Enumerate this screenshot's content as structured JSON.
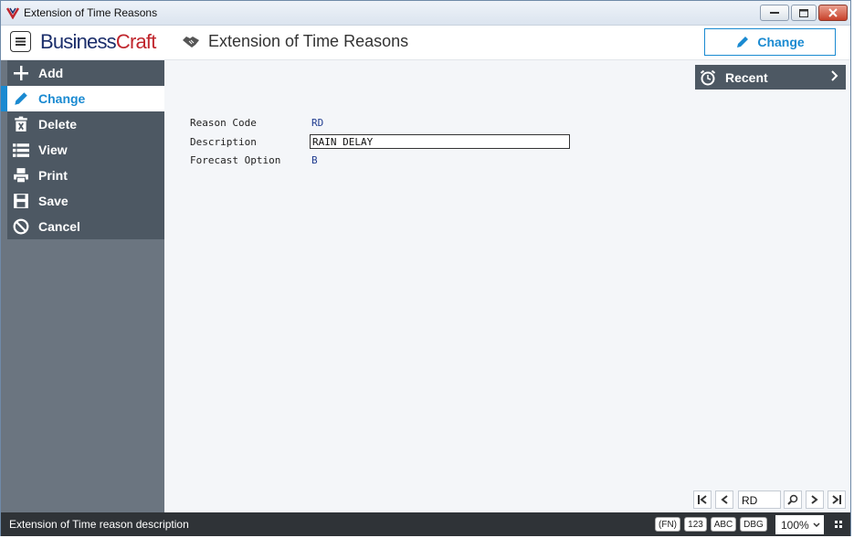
{
  "window": {
    "title": "Extension of Time Reasons"
  },
  "header": {
    "brand_part1": "Business",
    "brand_part2": "Craft",
    "page_title": "Extension of Time Reasons",
    "mode_label": "Change"
  },
  "sidebar": {
    "items": [
      {
        "label": "Add",
        "icon": "plus-icon"
      },
      {
        "label": "Change",
        "icon": "pencil-icon",
        "active": true
      },
      {
        "label": "Delete",
        "icon": "trash-icon"
      },
      {
        "label": "View",
        "icon": "list-icon"
      },
      {
        "label": "Print",
        "icon": "printer-icon"
      },
      {
        "label": "Save",
        "icon": "floppy-icon"
      },
      {
        "label": "Cancel",
        "icon": "cancel-icon"
      }
    ]
  },
  "recent": {
    "label": "Recent"
  },
  "form": {
    "reason_code_label": "Reason Code",
    "reason_code_value": "RD",
    "description_label": "Description",
    "description_value": "RAIN DELAY",
    "forecast_option_label": "Forecast Option",
    "forecast_option_value": "B"
  },
  "navigator": {
    "record_value": "RD"
  },
  "statusbar": {
    "text": "Extension of Time reason description",
    "badges": [
      "(FN)",
      "123",
      "ABC",
      "DBG"
    ],
    "zoom": "100%"
  },
  "colors": {
    "accent": "#1a8ad1",
    "brand_dark": "#1b2e6b",
    "brand_red": "#c0262d",
    "sidebar": "#4d5863"
  }
}
